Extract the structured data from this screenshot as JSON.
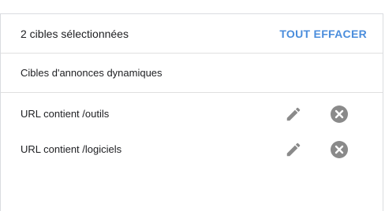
{
  "header": {
    "title": "2 cibles sélectionnées",
    "clear_all_label": "TOUT EFFACER"
  },
  "section": {
    "title": "Cibles d'annonces dynamiques"
  },
  "targets": [
    {
      "label": "URL contient /outils",
      "edit_icon": "pencil-icon",
      "remove_icon": "close-circle-icon"
    },
    {
      "label": "URL contient /logiciels",
      "edit_icon": "pencil-icon",
      "remove_icon": "close-circle-icon"
    }
  ],
  "colors": {
    "accent": "#4a8ddc",
    "icon": "#8a8a8a",
    "divider": "#e0e0e0",
    "text": "#202124"
  }
}
